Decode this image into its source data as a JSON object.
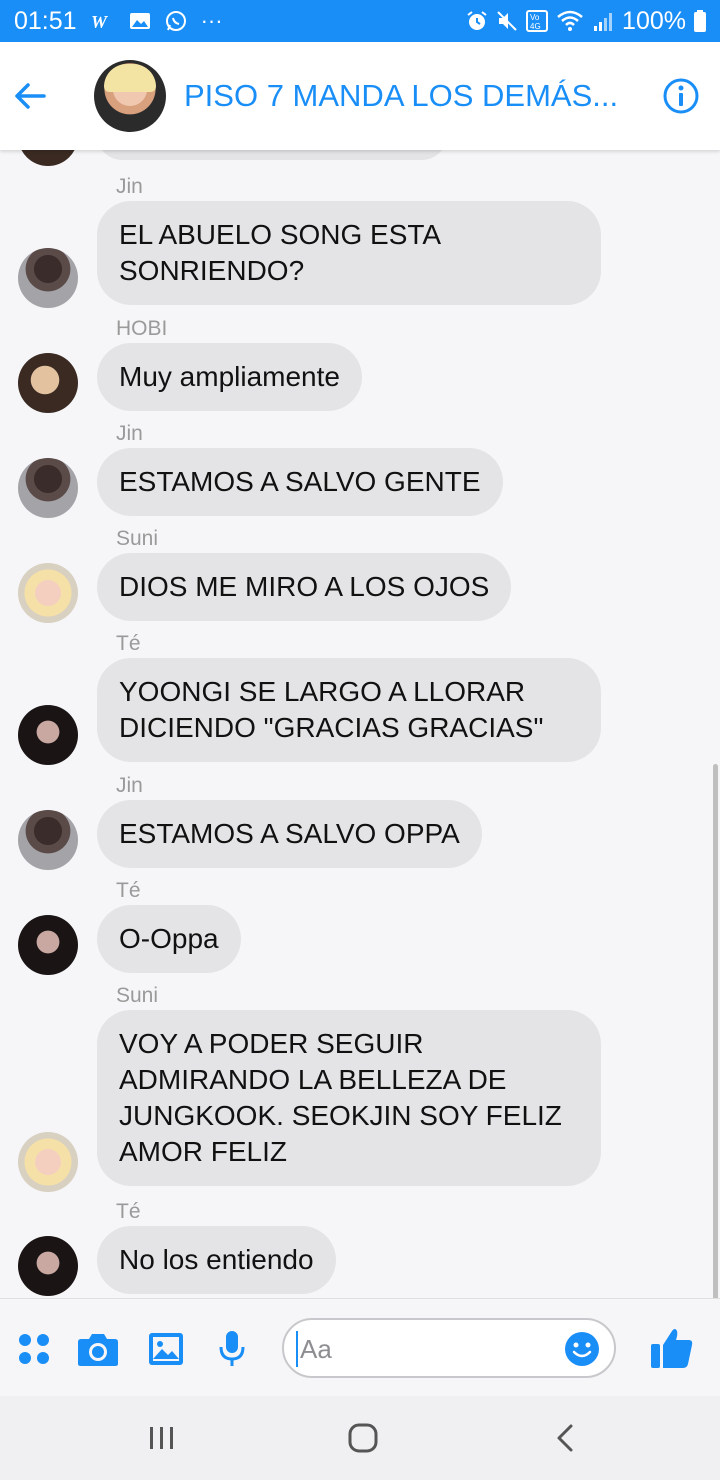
{
  "status": {
    "time": "01:51",
    "battery": "100%",
    "more": "···"
  },
  "header": {
    "title": "PISO 7 MANDA LOS DEMÁS..."
  },
  "messages": [
    {
      "sender": "Jin",
      "text": "EL ABUELO SONG ESTA SONRIENDO?"
    },
    {
      "sender": "HOBI",
      "text": "Muy ampliamente"
    },
    {
      "sender": "Jin",
      "text": "ESTAMOS A SALVO GENTE"
    },
    {
      "sender": "Suni",
      "text": "DIOS ME MIRO A LOS OJOS"
    },
    {
      "sender": "Té",
      "text": "YOONGI SE LARGO A LLORAR DICIENDO \"GRACIAS GRACIAS\""
    },
    {
      "sender": "Jin",
      "text": "ESTAMOS A SALVO OPPA"
    },
    {
      "sender": "Té",
      "text": "O-Oppa"
    },
    {
      "sender": "Suni",
      "text": "VOY A PODER SEGUIR ADMIRANDO LA BELLEZA DE JUNGKOOK. SEOKJIN SOY FELIZ AMOR FELIZ"
    },
    {
      "sender": "Té",
      "text": "No los entiendo"
    }
  ],
  "composer": {
    "placeholder": "Aa"
  },
  "colors": {
    "accent": "#1a8ef7",
    "bubble": "#e4e4e6"
  },
  "icons": [
    "back-arrow-icon",
    "info-icon",
    "menu-dots-icon",
    "camera-icon",
    "gallery-icon",
    "microphone-icon",
    "emoji-icon",
    "thumbs-up-icon",
    "recent-apps-icon",
    "home-icon",
    "nav-back-icon"
  ]
}
